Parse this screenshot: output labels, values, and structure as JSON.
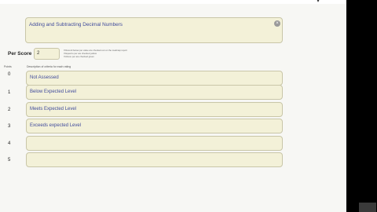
{
  "title_field": {
    "value": "Adding and Subtracting Decimal Numbers"
  },
  "per_score": {
    "label": "Per Score",
    "value": "2",
    "hints": [
      "If Record below per value are checked out on the roadmap report",
      "If Equal to per are checked yellow",
      "If Above per are checked green"
    ]
  },
  "rubric": {
    "points_header": "Points",
    "description_header": "Description of criteria for each rating",
    "rows": [
      {
        "points": "0",
        "label": "Not Assessed"
      },
      {
        "points": "1",
        "label": "Below Expected Level"
      },
      {
        "points": "2",
        "label": "Meets Expected Level"
      },
      {
        "points": "3",
        "label": "Exceeds expected Level"
      },
      {
        "points": "4",
        "label": ""
      },
      {
        "points": "5",
        "label": ""
      }
    ]
  },
  "colors": {
    "field_fill": "#f3f1d8",
    "field_text": "#3f4a9c",
    "background": "#f7f7f4"
  }
}
